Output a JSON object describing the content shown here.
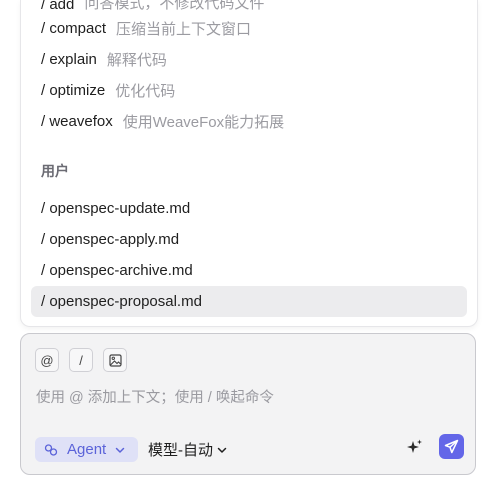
{
  "commands": [
    {
      "name": "/ add",
      "desc": "问答模式，不修改代码文件"
    },
    {
      "name": "/ compact",
      "desc": "压缩当前上下文窗口"
    },
    {
      "name": "/ explain",
      "desc": "解释代码"
    },
    {
      "name": "/ optimize",
      "desc": "优化代码"
    },
    {
      "name": "/ weavefox",
      "desc": "使用WeaveFox能力拓展"
    }
  ],
  "section_title": "用户",
  "files": [
    {
      "name": "/ openspec-update.md"
    },
    {
      "name": "/ openspec-apply.md"
    },
    {
      "name": "/ openspec-archive.md"
    },
    {
      "name": "/ openspec-proposal.md",
      "active": true
    }
  ],
  "composer": {
    "mention_label": "@",
    "slash_label": "/",
    "placeholder": "使用 @ 添加上下文；使用 / 唤起命令",
    "mode_label": "Agent",
    "model_label": "模型-自动"
  },
  "colors": {
    "accent": "#6366e8",
    "pill_bg": "#dfe1f7",
    "active_row": "#ececee"
  }
}
